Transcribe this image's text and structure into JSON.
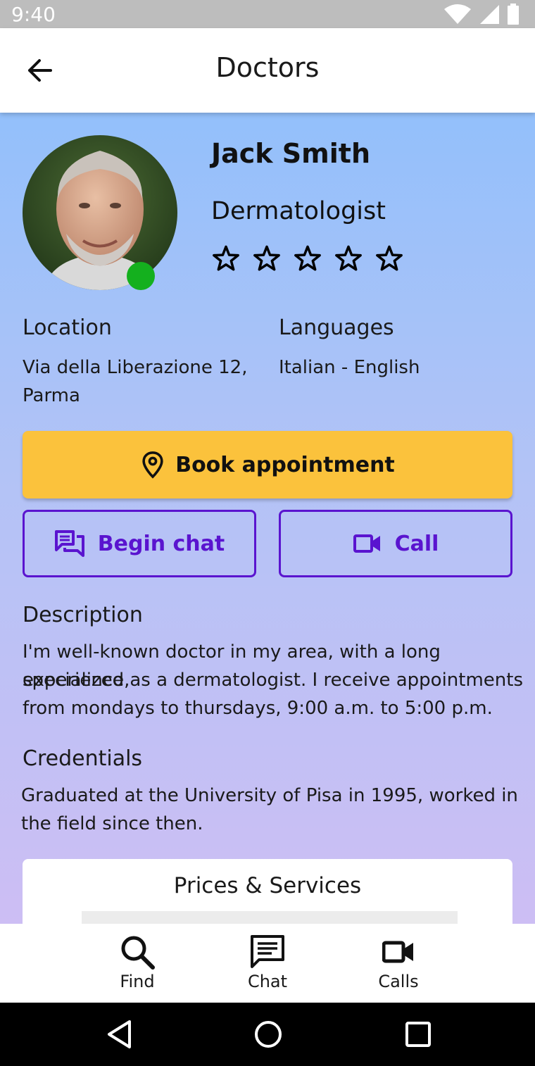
{
  "status_bar": {
    "time": "9:40"
  },
  "app_bar": {
    "title": "Doctors"
  },
  "doctor": {
    "name": "Jack Smith",
    "specialty": "Dermatologist",
    "rating": 0,
    "rating_max": 5,
    "online": true,
    "online_color": "#14b01e"
  },
  "location": {
    "label": "Location",
    "value_line1": "Via della Liberazione 12,",
    "value_line2": "Parma"
  },
  "languages": {
    "label": "Languages",
    "value": "Italian - English"
  },
  "actions": {
    "book_label": "Book appointment",
    "chat_label": "Begin chat",
    "call_label": "Call",
    "book_color": "#fbc23c",
    "accent_color": "#5a14cf"
  },
  "description": {
    "label": "Description",
    "lines": [
      "I'm well-known doctor in my area, with a long experience,",
      "specialized as a dermatologist. I receive appointments",
      "from mondays to thursdays, 9:00 a.m. to 5:00 p.m."
    ]
  },
  "credentials": {
    "label": "Credentials",
    "lines": [
      "Graduated at the University of Pisa in 1995, worked in",
      "the field since then."
    ]
  },
  "prices": {
    "title": "Prices & Services"
  },
  "bottom_nav": {
    "items": [
      {
        "label": "Find",
        "icon": "search-icon"
      },
      {
        "label": "Chat",
        "icon": "chat-icon"
      },
      {
        "label": "Calls",
        "icon": "video-camera-icon"
      }
    ]
  },
  "system_nav": {
    "icons": [
      "back-triangle-icon",
      "home-circle-icon",
      "recents-square-icon"
    ]
  }
}
